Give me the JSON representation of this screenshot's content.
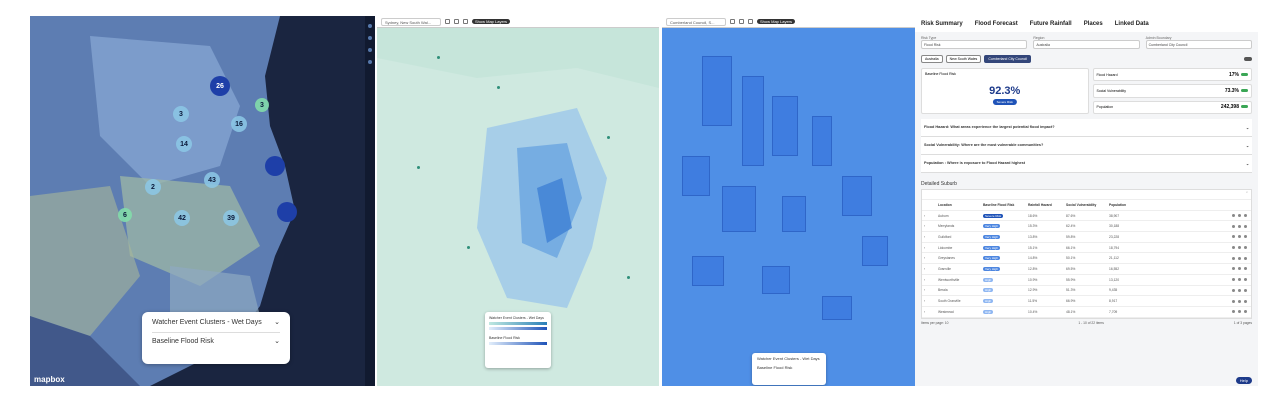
{
  "panel1": {
    "clusters": [
      {
        "label": "26",
        "kind": "dark"
      },
      {
        "label": "3",
        "kind": "green"
      },
      {
        "label": "3",
        "kind": "light"
      },
      {
        "label": "16",
        "kind": "light"
      },
      {
        "label": "14",
        "kind": "light"
      },
      {
        "label": "43",
        "kind": "light"
      },
      {
        "label": "2",
        "kind": "light"
      },
      {
        "label": "42",
        "kind": "light"
      },
      {
        "label": "39",
        "kind": "light"
      },
      {
        "label": "6",
        "kind": "green"
      },
      {
        "label": "",
        "kind": "dark"
      },
      {
        "label": "",
        "kind": "dark"
      }
    ],
    "legend": {
      "item1": "Watcher Event Clusters - Wet Days",
      "item2": "Baseline Flood Risk"
    },
    "logo": "mapbox"
  },
  "panel2": {
    "search": "Sydney, New South Wal...",
    "chip": "Show Map Layers",
    "legend": {
      "item1": "Watcher Event Clusters - Wet Days",
      "item2": "Baseline Flood Risk"
    }
  },
  "panel3": {
    "search": "Cumberland Council, S...",
    "chip": "Show Map Layers",
    "legend": {
      "item1": "Watcher Event Clusters - Wet Days",
      "item2": "Baseline Flood Risk"
    }
  },
  "dashboard": {
    "tabs": [
      "Risk Summary",
      "Flood Forecast",
      "Future Rainfall",
      "Places",
      "Linked Data"
    ],
    "filters": [
      {
        "label": "Risk Type",
        "value": "Flood Risk"
      },
      {
        "label": "Region",
        "value": "Australia"
      },
      {
        "label": "Admin Boundary",
        "value": "Cumberland City Council"
      }
    ],
    "crumbs": [
      "Australia",
      "New South Wales",
      "Cumberland City Council"
    ],
    "kpi_main": {
      "label": "Baseline Flood Risk",
      "value": "92.3%",
      "badge": "Severe Risk"
    },
    "kpis": [
      {
        "label": "Flood Hazard",
        "value": "17%"
      },
      {
        "label": "Social Vulnerability",
        "value": "73.3%"
      },
      {
        "label": "Population",
        "value": "242,398"
      }
    ],
    "questions": [
      "Flood Hazard: What areas experience the largest potential flood impact?",
      "Social Vulnerability: Where are the most vulnerable communities?",
      "Population : Where is exposure to Flood Hazard highest"
    ],
    "table_title": "Detailed Suburb",
    "table_head": [
      "Location",
      "Baseline Flood Risk",
      "Rainfall Hazard",
      "Social Vulnerability",
      "Population"
    ],
    "rows": [
      {
        "location": "Auburn",
        "risk": "Severe Risk",
        "level": "vh",
        "hazard": "18.6%",
        "social": "87.6%",
        "pop": "38,907"
      },
      {
        "location": "Merrylands",
        "risk": "Very High",
        "level": "h",
        "hazard": "15.3%",
        "social": "62.4%",
        "pop": "30,188"
      },
      {
        "location": "Guildford",
        "risk": "Very High",
        "level": "h",
        "hazard": "13.8%",
        "social": "59.8%",
        "pop": "23,228"
      },
      {
        "location": "Lidcombe",
        "risk": "Very High",
        "level": "h",
        "hazard": "15.1%",
        "social": "66.1%",
        "pop": "18,794"
      },
      {
        "location": "Greystanes",
        "risk": "Very High",
        "level": "h",
        "hazard": "14.8%",
        "social": "50.1%",
        "pop": "21,112"
      },
      {
        "location": "Granville",
        "risk": "Very High",
        "level": "h",
        "hazard": "12.8%",
        "social": "69.5%",
        "pop": "16,552"
      },
      {
        "location": "Wentworthville",
        "risk": "High",
        "level": "l",
        "hazard": "10.9%",
        "social": "55.9%",
        "pop": "13,120"
      },
      {
        "location": "Berala",
        "risk": "High",
        "level": "l",
        "hazard": "12.9%",
        "social": "51.3%",
        "pop": "9,435"
      },
      {
        "location": "South Granville",
        "risk": "High",
        "level": "l",
        "hazard": "11.5%",
        "social": "66.9%",
        "pop": "8,917"
      },
      {
        "location": "Westmead",
        "risk": "High",
        "level": "l",
        "hazard": "10.4%",
        "social": "48.1%",
        "pop": "7,709"
      }
    ],
    "pager_left": "Items per page: 10",
    "pager_mid": "1 - 10 of 22 items",
    "pager_right": "1 of 3 pages",
    "help": "Help"
  }
}
